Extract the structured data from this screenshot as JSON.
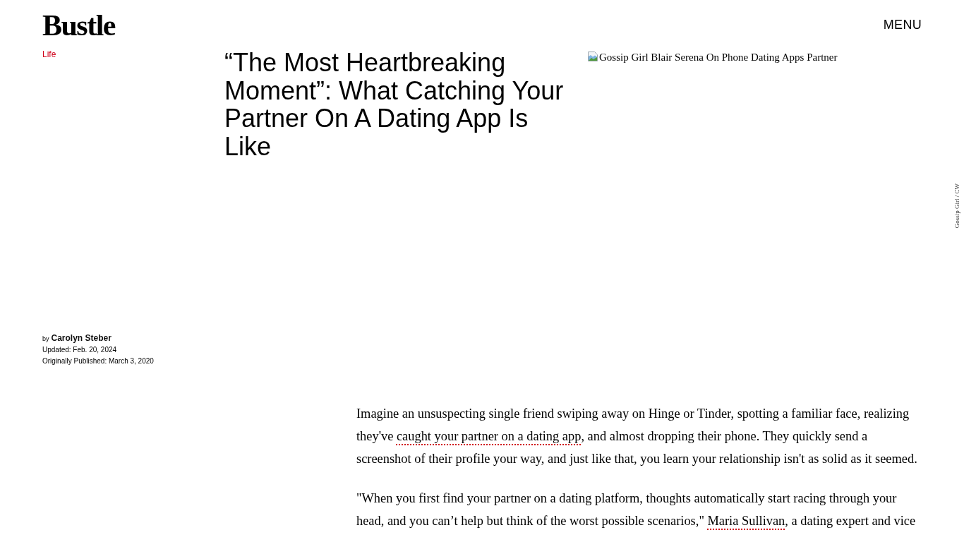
{
  "header": {
    "logo": "Bustle",
    "menu": "MENU"
  },
  "article": {
    "category": "Life",
    "title": "“The Most Heartbreaking Moment”: What Catching Your Partner On A Dating App Is Like",
    "image": {
      "alt": "Gossip Girl Blair Serena On Phone Dating Apps Partner",
      "credit": "Gossip Girl / CW"
    },
    "byline": {
      "prefix": "by",
      "author": "Carolyn Steber",
      "updated": "Updated: Feb. 20, 2024",
      "published": "Originally Published: March 3, 2020"
    },
    "paragraphs": [
      {
        "segments": [
          {
            "kind": "text",
            "text": "Imagine an unsuspecting single friend swiping away on Hinge or Tinder, spotting a familiar face, realizing they've "
          },
          {
            "kind": "link",
            "text": "caught your partner on a dating app"
          },
          {
            "kind": "text",
            "text": ", and almost dropping their phone. They quickly send a screenshot of their profile your way, and just like that, you learn your relationship isn't as solid as it seemed."
          }
        ]
      },
      {
        "segments": [
          {
            "kind": "text",
            "text": "\"When you first find your partner on a dating platform, thoughts automatically start racing through your head, and you can’t help but think of the worst possible scenarios,\" "
          },
          {
            "kind": "link",
            "text": "Maria Sullivan"
          },
          {
            "kind": "text",
            "text": ", a dating expert and vice"
          }
        ]
      }
    ]
  }
}
